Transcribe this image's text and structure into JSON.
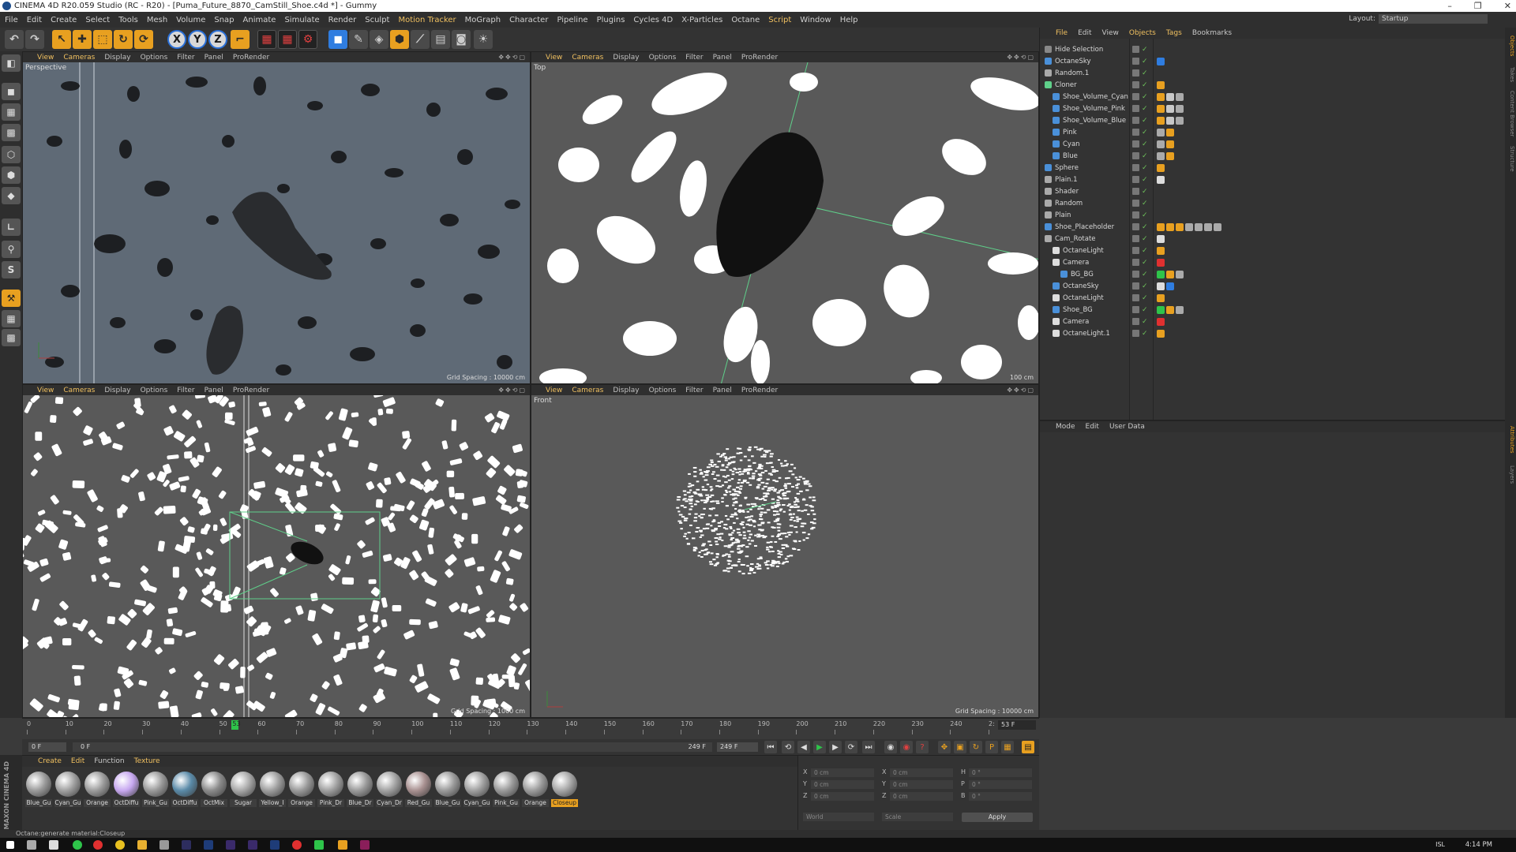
{
  "window": {
    "title": "CINEMA 4D R20.059 Studio (RC - R20) - [Puma_Future_8870_CamStill_Shoe.c4d *] - Gummy",
    "min": "–",
    "max": "❐",
    "close": "✕"
  },
  "menubar": {
    "items": [
      "File",
      "Edit",
      "Create",
      "Select",
      "Tools",
      "Mesh",
      "Volume",
      "Snap",
      "Animate",
      "Simulate",
      "Render",
      "Sculpt",
      "Motion Tracker",
      "MoGraph",
      "Character",
      "Pipeline",
      "Plugins",
      "Cycles 4D",
      "X-Particles",
      "Octane",
      "Script",
      "Window",
      "Help"
    ],
    "layout_label": "Layout:",
    "layout_value": "Startup"
  },
  "toolbar": {
    "axis_x": "X",
    "axis_y": "Y",
    "axis_z": "Z"
  },
  "leftbar": {
    "s_label": "S"
  },
  "viewports": {
    "menu": [
      "View",
      "Cameras",
      "Display",
      "Options",
      "Filter",
      "Panel",
      "ProRender"
    ],
    "perspective": {
      "name": "Perspective",
      "grid": "Grid Spacing : 10000 cm"
    },
    "top": {
      "name": "Top",
      "grid": "100 cm"
    },
    "right": {
      "name": "",
      "grid": "Grid Spacing : 1000 cm"
    },
    "front": {
      "name": "Front",
      "grid": "Grid Spacing : 10000 cm"
    }
  },
  "objects": {
    "menu": [
      "File",
      "Edit",
      "View",
      "Objects",
      "Tags",
      "Bookmarks"
    ],
    "rows": [
      {
        "name": "Hide Selection",
        "indent": 0
      },
      {
        "name": "OctaneSky",
        "indent": 0
      },
      {
        "name": "Random.1",
        "indent": 0
      },
      {
        "name": "Cloner",
        "indent": 0
      },
      {
        "name": "Shoe_Volume_Cyan",
        "indent": 1
      },
      {
        "name": "Shoe_Volume_Pink",
        "indent": 1
      },
      {
        "name": "Shoe_Volume_Blue",
        "indent": 1
      },
      {
        "name": "Pink",
        "indent": 1
      },
      {
        "name": "Cyan",
        "indent": 1
      },
      {
        "name": "Blue",
        "indent": 1
      },
      {
        "name": "Sphere",
        "indent": 0
      },
      {
        "name": "Plain.1",
        "indent": 0
      },
      {
        "name": "Shader",
        "indent": 0
      },
      {
        "name": "Random",
        "indent": 0
      },
      {
        "name": "Plain",
        "indent": 0
      },
      {
        "name": "Shoe_Placeholder",
        "indent": 0
      },
      {
        "name": "Cam_Rotate",
        "indent": 0
      },
      {
        "name": "OctaneLight",
        "indent": 1
      },
      {
        "name": "Camera",
        "indent": 1
      },
      {
        "name": "BG_BG",
        "indent": 2
      },
      {
        "name": "OctaneSky",
        "indent": 1
      },
      {
        "name": "OctaneLight",
        "indent": 1
      },
      {
        "name": "Shoe_BG",
        "indent": 1
      },
      {
        "name": "Camera",
        "indent": 1
      },
      {
        "name": "OctaneLight.1",
        "indent": 1
      }
    ]
  },
  "attributes": {
    "menu": [
      "Mode",
      "Edit",
      "User Data"
    ]
  },
  "righttabs": [
    "Objects",
    "Takes",
    "Content Browser",
    "Structure",
    "Attributes",
    "Layers"
  ],
  "timeline": {
    "ticks": [
      "0",
      "10",
      "20",
      "30",
      "40",
      "50",
      "60",
      "70",
      "80",
      "90",
      "100",
      "110",
      "120",
      "130",
      "140",
      "150",
      "160",
      "170",
      "180",
      "190",
      "200",
      "210",
      "220",
      "230",
      "240",
      "2:"
    ],
    "current_marker": "53",
    "current_frame": "53 F",
    "playhead_fraction": 0.213
  },
  "transport": {
    "start": "0 F",
    "range_start": "0 F",
    "range_end": "249 F",
    "end": "249 F"
  },
  "materials": {
    "menu": [
      "Create",
      "Edit",
      "Function",
      "Texture"
    ],
    "items": [
      {
        "label": "Blue_Gu",
        "color": "#9a9a9a",
        "selected": false
      },
      {
        "label": "Cyan_Gu",
        "color": "#a0a0a0",
        "selected": false
      },
      {
        "label": "Orange",
        "color": "#9c9c9c",
        "selected": false
      },
      {
        "label": "OctDiffu",
        "color": "#c7a8f0",
        "selected": false
      },
      {
        "label": "Pink_Gu",
        "color": "#9a9a9a",
        "selected": false
      },
      {
        "label": "OctDiffu",
        "color": "#5a8aa8",
        "selected": false
      },
      {
        "label": "OctMix",
        "color": "#8a8a8a",
        "selected": false
      },
      {
        "label": "Sugar",
        "color": "#a8a8a8",
        "selected": false
      },
      {
        "label": "Yellow_I",
        "color": "#9e9e9e",
        "selected": false
      },
      {
        "label": "Orange",
        "color": "#9a9a9a",
        "selected": false
      },
      {
        "label": "Pink_Dr",
        "color": "#a0a0a0",
        "selected": false
      },
      {
        "label": "Blue_Dr",
        "color": "#9a9a9a",
        "selected": false
      },
      {
        "label": "Cyan_Dr",
        "color": "#a2a2a2",
        "selected": false
      },
      {
        "label": "Red_Gu",
        "color": "#a89090",
        "selected": false
      },
      {
        "label": "Blue_Gu",
        "color": "#9a9a9a",
        "selected": false
      },
      {
        "label": "Cyan_Gu",
        "color": "#a0a0a0",
        "selected": false
      },
      {
        "label": "Pink_Gu",
        "color": "#9a9a9a",
        "selected": false
      },
      {
        "label": "Orange",
        "color": "#9c9c9c",
        "selected": false
      },
      {
        "label": "Closeup",
        "color": "#a6a6a6",
        "selected": true
      }
    ]
  },
  "coordinates": {
    "rows": [
      {
        "a": "X",
        "av": "0 cm",
        "b": "X",
        "bv": "0 cm",
        "c": "H",
        "cv": "0 °"
      },
      {
        "a": "Y",
        "av": "0 cm",
        "b": "Y",
        "bv": "0 cm",
        "c": "P",
        "cv": "0 °"
      },
      {
        "a": "Z",
        "av": "0 cm",
        "b": "Z",
        "bv": "0 cm",
        "c": "B",
        "cv": "0 °"
      }
    ],
    "mode": "World",
    "size_mode": "Scale",
    "apply": "Apply"
  },
  "brand": "MAXON CINEMA 4D",
  "status": "Octane:generate material:Closeup",
  "taskbar": {
    "lang": "ISL",
    "time": "4:14 PM"
  },
  "colors": {
    "accent": "#f0c060",
    "selection_orange": "#e8a020",
    "playhead": "#2ec44a",
    "helper_green": "#5fd08a"
  }
}
